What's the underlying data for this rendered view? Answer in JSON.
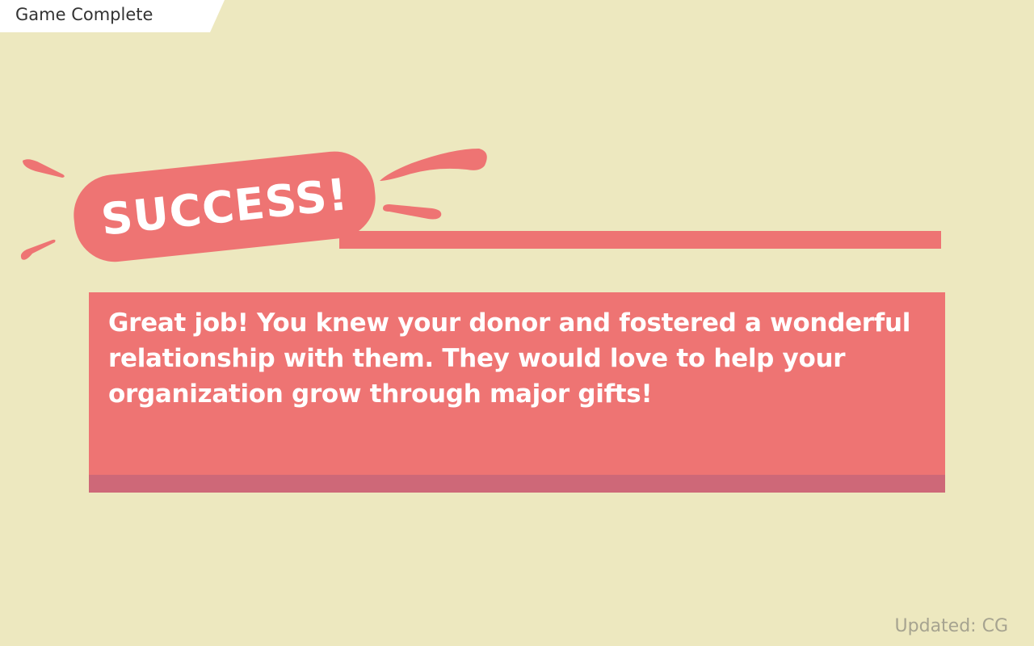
{
  "header": {
    "title": "Game Complete"
  },
  "result": {
    "banner": "SUCCESS!",
    "message": "Great job! You knew your donor and fostered a wonderful relationship with them. They would love to help your organization grow through major gifts!"
  },
  "footer": {
    "updated": "Updated: CG"
  },
  "colors": {
    "background": "#ede8bf",
    "accent": "#ee7473",
    "panel_shadow": "#ce6878",
    "tab": "#ffffff"
  }
}
